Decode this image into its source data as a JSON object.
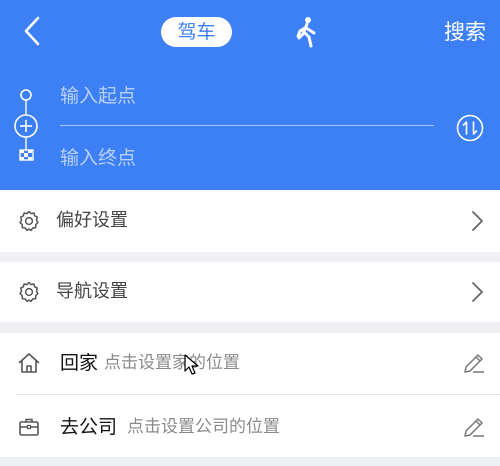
{
  "header": {
    "mode_tabs": [
      {
        "label": "驾车",
        "selected": true
      },
      {
        "label": "步行",
        "selected": false
      }
    ],
    "search_label": "搜索",
    "start_placeholder": "输入起点",
    "end_placeholder": "输入终点"
  },
  "settings": {
    "preference_label": "偏好设置",
    "navigation_label": "导航设置"
  },
  "places": {
    "home": {
      "name": "回家",
      "hint": "点击设置家的位置"
    },
    "work": {
      "name": "去公司",
      "hint": "点击设置公司的位置"
    }
  },
  "colors": {
    "accent": "#3d7ff5",
    "page_bg": "#eef0f4"
  }
}
